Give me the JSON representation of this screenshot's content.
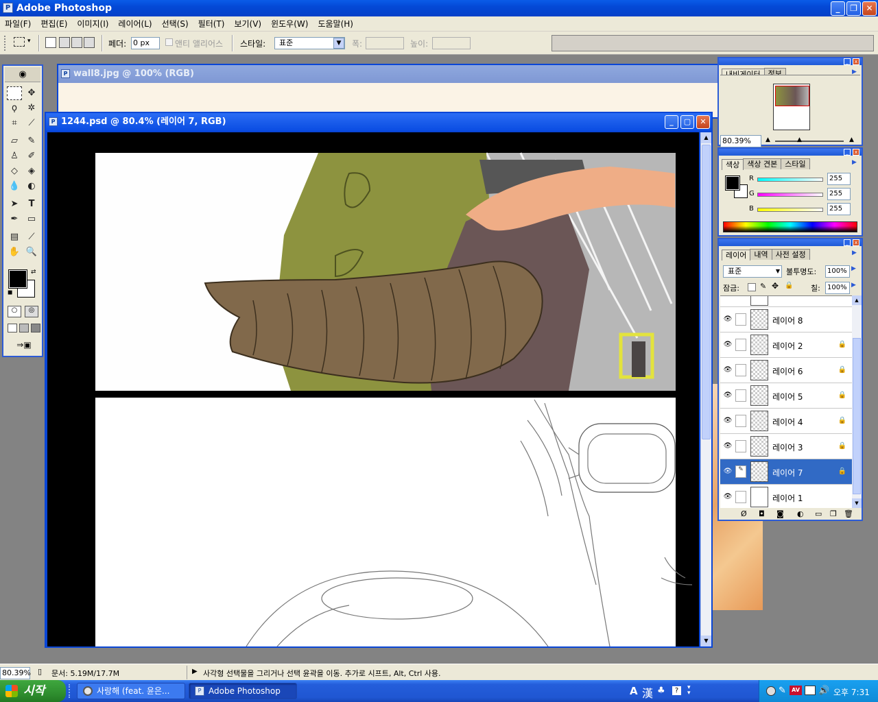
{
  "app": {
    "title": "Adobe Photoshop",
    "icon": "photoshop-icon"
  },
  "menu": [
    "파일(F)",
    "편집(E)",
    "이미지(I)",
    "레이어(L)",
    "선택(S)",
    "필터(T)",
    "보기(V)",
    "윈도우(W)",
    "도움말(H)"
  ],
  "options": {
    "feather_label": "페더:",
    "feather_value": "0 px",
    "antialias_label": "앤티 앨리어스",
    "style_label": "스타일:",
    "style_value": "표준",
    "width_label": "폭:",
    "height_label": "높이:"
  },
  "bg_doc": {
    "title": "wall8.jpg @ 100% (RGB)"
  },
  "main_doc": {
    "title": "1244.psd @ 80.4% (레이어 7, RGB)"
  },
  "navigator": {
    "tabs": [
      "내비게이터",
      "정보"
    ],
    "zoom": "80.39%"
  },
  "color": {
    "tabs": [
      "색상",
      "색상 견본",
      "스타일"
    ],
    "channels": [
      {
        "label": "R",
        "value": "255"
      },
      {
        "label": "G",
        "value": "255"
      },
      {
        "label": "B",
        "value": "255"
      }
    ]
  },
  "layers": {
    "tabs": [
      "레이어",
      "내역",
      "사전 설정"
    ],
    "blend_mode": "표준",
    "opacity_label": "불투명도:",
    "opacity": "100%",
    "lock_label": "잠금:",
    "fill_label": "칠:",
    "fill": "100%",
    "items": [
      {
        "name": "레이어 8",
        "locked": false,
        "selected": false
      },
      {
        "name": "레이어 2",
        "locked": true,
        "selected": false
      },
      {
        "name": "레이어 6",
        "locked": true,
        "selected": false
      },
      {
        "name": "레이어 5",
        "locked": true,
        "selected": false
      },
      {
        "name": "레이어 4",
        "locked": true,
        "selected": false
      },
      {
        "name": "레이어 3",
        "locked": true,
        "selected": false
      },
      {
        "name": "레이어 7",
        "locked": true,
        "selected": true
      },
      {
        "name": "레이어 1",
        "locked": false,
        "selected": false
      }
    ]
  },
  "status": {
    "zoom": "80.39%",
    "doc_size": "문서: 5.19M/17.7M",
    "hint": "사각형 선택물을 그리거나 선택 윤곽을 이동. 추가로 시프트, Alt, Ctrl 사용."
  },
  "taskbar": {
    "start": "시작",
    "tasks": [
      "사랑해 (feat. 윤은...",
      "Adobe Photoshop"
    ],
    "ime_a": "A",
    "ime_han": "漢",
    "clock": "오후 7:31"
  },
  "colors": {
    "titlebar": "#0a46d6",
    "selected_layer": "#316ac5",
    "chrome": "#ece9d8"
  }
}
